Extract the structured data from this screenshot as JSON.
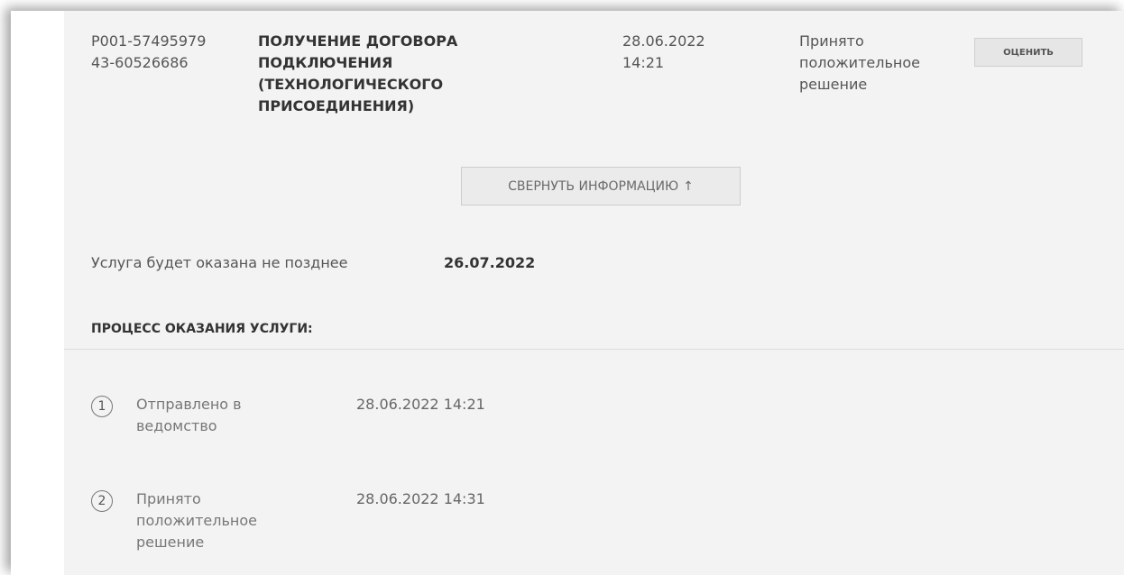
{
  "request": {
    "id": "P001-5749597943-60526686",
    "service_title": "ПОЛУЧЕНИЕ ДОГОВОРА ПОДКЛЮЧЕНИЯ (ТЕХНОЛОГИЧЕСКОГО ПРИСОЕДИНЕНИЯ)",
    "date": "28.06.2022 14:21",
    "status": "Принято положительное решение",
    "rate_button_label": "ОЦЕНИТЬ"
  },
  "collapse_button": {
    "label": "СВЕРНУТЬ ИНФОРМАЦИЮ",
    "arrow": "↑"
  },
  "deadline": {
    "label": "Услуга будет оказана не позднее",
    "date": "26.07.2022"
  },
  "process": {
    "heading": "ПРОЦЕСС ОКАЗАНИЯ УСЛУГИ:",
    "steps": [
      {
        "number": "1",
        "label": "Отправлено в ведомство",
        "date": "28.06.2022 14:21"
      },
      {
        "number": "2",
        "label": "Принято положительное решение",
        "date": "28.06.2022 14:31"
      }
    ]
  }
}
